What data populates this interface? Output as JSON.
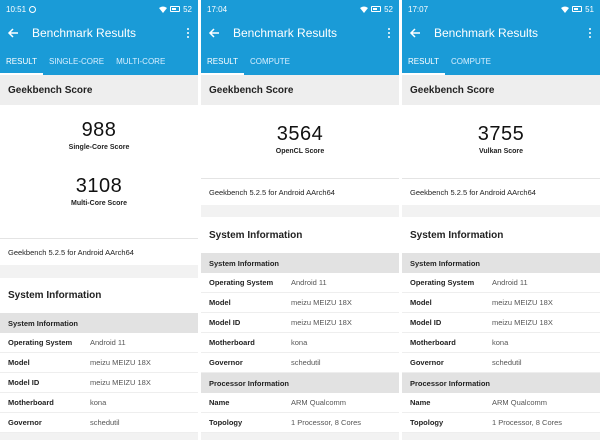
{
  "screens": [
    {
      "status": {
        "time": "10:51",
        "battery": "52"
      },
      "appbar": {
        "title": "Benchmark Results"
      },
      "tabs": [
        {
          "label": "RESULT",
          "active": true
        },
        {
          "label": "SINGLE-CORE",
          "active": false
        },
        {
          "label": "MULTI-CORE",
          "active": false
        }
      ],
      "section_title": "Geekbench Score",
      "scores": [
        {
          "value": "988",
          "label": "Single-Core Score"
        },
        {
          "value": "3108",
          "label": "Multi-Core Score"
        }
      ],
      "version": "Geekbench 5.2.5 for Android AArch64",
      "sysinfo_title": "System Information",
      "groups": [
        {
          "title": "System Information",
          "rows": [
            {
              "key": "Operating System",
              "value": "Android 11"
            },
            {
              "key": "Model",
              "value": "meizu MEIZU 18X"
            },
            {
              "key": "Model ID",
              "value": "meizu MEIZU 18X"
            },
            {
              "key": "Motherboard",
              "value": "kona"
            },
            {
              "key": "Governor",
              "value": "schedutil"
            }
          ]
        }
      ]
    },
    {
      "status": {
        "time": "17:04",
        "battery": "52"
      },
      "appbar": {
        "title": "Benchmark Results"
      },
      "tabs": [
        {
          "label": "RESULT",
          "active": true
        },
        {
          "label": "COMPUTE",
          "active": false
        }
      ],
      "section_title": "Geekbench Score",
      "scores": [
        {
          "value": "3564",
          "label": "OpenCL Score"
        }
      ],
      "version": "Geekbench 5.2.5 for Android AArch64",
      "sysinfo_title": "System Information",
      "groups": [
        {
          "title": "System Information",
          "rows": [
            {
              "key": "Operating System",
              "value": "Android 11"
            },
            {
              "key": "Model",
              "value": "meizu MEIZU 18X"
            },
            {
              "key": "Model ID",
              "value": "meizu MEIZU 18X"
            },
            {
              "key": "Motherboard",
              "value": "kona"
            },
            {
              "key": "Governor",
              "value": "schedutil"
            }
          ]
        },
        {
          "title": "Processor Information",
          "rows": [
            {
              "key": "Name",
              "value": "ARM Qualcomm"
            },
            {
              "key": "Topology",
              "value": "1 Processor, 8 Cores"
            }
          ]
        }
      ]
    },
    {
      "status": {
        "time": "17:07",
        "battery": "51"
      },
      "appbar": {
        "title": "Benchmark Results"
      },
      "tabs": [
        {
          "label": "RESULT",
          "active": true
        },
        {
          "label": "COMPUTE",
          "active": false
        }
      ],
      "section_title": "Geekbench Score",
      "scores": [
        {
          "value": "3755",
          "label": "Vulkan Score"
        }
      ],
      "version": "Geekbench 5.2.5 for Android AArch64",
      "sysinfo_title": "System Information",
      "groups": [
        {
          "title": "System Information",
          "rows": [
            {
              "key": "Operating System",
              "value": "Android 11"
            },
            {
              "key": "Model",
              "value": "meizu MEIZU 18X"
            },
            {
              "key": "Model ID",
              "value": "meizu MEIZU 18X"
            },
            {
              "key": "Motherboard",
              "value": "kona"
            },
            {
              "key": "Governor",
              "value": "schedutil"
            }
          ]
        },
        {
          "title": "Processor Information",
          "rows": [
            {
              "key": "Name",
              "value": "ARM Qualcomm"
            },
            {
              "key": "Topology",
              "value": "1 Processor, 8 Cores"
            }
          ]
        }
      ]
    }
  ],
  "theme": {
    "primary": "#1a9bd7"
  },
  "icons": {
    "back": "arrow-left-icon",
    "more": "more-vert-icon",
    "wifi": "wifi-icon",
    "battery": "battery-icon"
  }
}
